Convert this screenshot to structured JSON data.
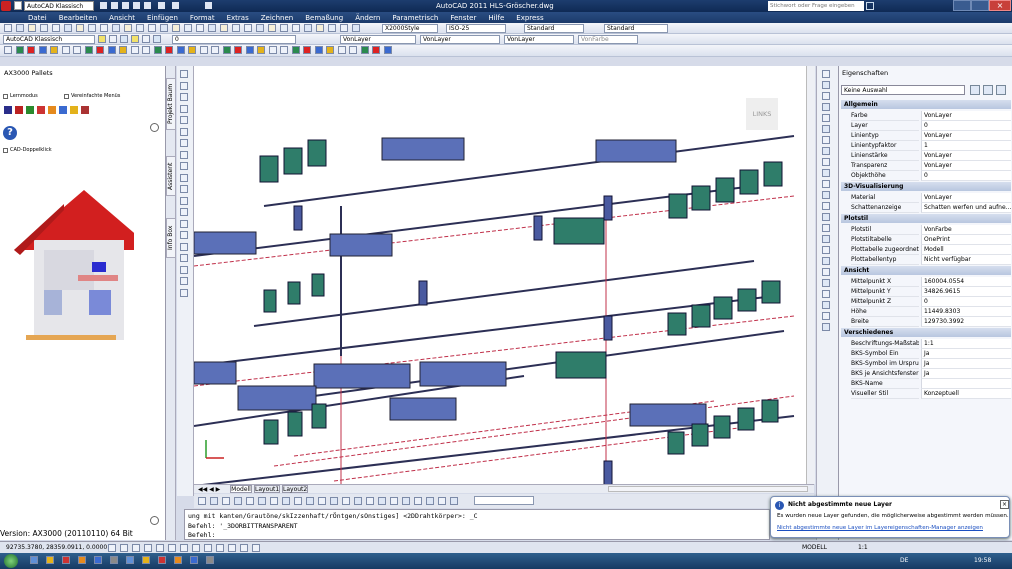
{
  "title_bar": {
    "app_title": "AutoCAD 2011   HLS-Gröscher.dwg",
    "workspace": "AutoCAD Klassisch",
    "search_placeholder": "Stichwort oder Frage eingeben"
  },
  "menu": [
    "Datei",
    "Bearbeiten",
    "Ansicht",
    "Einfügen",
    "Format",
    "Extras",
    "Zeichnen",
    "Bemaßung",
    "Ändern",
    "Parametrisch",
    "Fenster",
    "Hilfe",
    "Express"
  ],
  "toolbar": {
    "text_style": "X2000Style",
    "dim_style": "ISO-25",
    "table_style": "Standard",
    "mleader_style": "Standard",
    "workspace_select": "AutoCAD Klassisch",
    "layer_select": "0",
    "color_select": "VonLayer",
    "linetype_select": "VonLayer",
    "lineweight_select": "VonLayer",
    "plotstyle_select": "VonFarbe"
  },
  "left_panel": {
    "title": "AX3000 Pallets",
    "checkbox_lernmodus": "Lernmodus",
    "checkbox_menu": "Vereinfachte Menüs",
    "checkbox_cad": "CAD-Doppelklick",
    "version": "Version: AX3000 (20110110) 64 Bit"
  },
  "vertical_tabs": [
    "Projekt Baum",
    "Assistent",
    "Info Box"
  ],
  "viewcube_label": "LINKS",
  "layout_tabs": [
    "Modell",
    "Layout1",
    "Layout2"
  ],
  "command": {
    "line1": "ung mit kanten/Grautöne/skIzzenhaft/rÖntgen/sOnstiges] <2DDrahtkörper>: _C",
    "line2": "Befehl: '_3DORBITTRANSPARENT",
    "line3": "Befehl:"
  },
  "properties": {
    "title": "Eigenschaften",
    "selection": "Keine Auswahl",
    "sections": [
      {
        "name": "Allgemein",
        "rows": [
          [
            "Farbe",
            "VonLayer"
          ],
          [
            "Layer",
            "0"
          ],
          [
            "Linientyp",
            "VonLayer"
          ],
          [
            "Linientypfaktor",
            "1"
          ],
          [
            "Linienstärke",
            "VonLayer"
          ],
          [
            "Transparenz",
            "VonLayer"
          ],
          [
            "Objekthöhe",
            "0"
          ]
        ]
      },
      {
        "name": "3D-Visualisierung",
        "rows": [
          [
            "Material",
            "VonLayer"
          ],
          [
            "Schattenanzeige",
            "Schatten werfen und aufne..."
          ]
        ]
      },
      {
        "name": "Plotstil",
        "rows": [
          [
            "Plotstil",
            "VonFarbe"
          ],
          [
            "Plotstiltabelle",
            "OnePrint"
          ],
          [
            "Plottabelle zugeordnet...",
            "Modell"
          ],
          [
            "Plottabellentyp",
            "Nicht verfügbar"
          ]
        ]
      },
      {
        "name": "Ansicht",
        "rows": [
          [
            "Mittelpunkt X",
            "160004.0554"
          ],
          [
            "Mittelpunkt Y",
            "34826.9615"
          ],
          [
            "Mittelpunkt Z",
            "0"
          ],
          [
            "Höhe",
            "11449.8303"
          ],
          [
            "Breite",
            "129730.3992"
          ]
        ]
      },
      {
        "name": "Verschiedenes",
        "rows": [
          [
            "Beschriftungs-Maßstab",
            "1:1"
          ],
          [
            "BKS-Symbol Ein",
            "Ja"
          ],
          [
            "BKS-Symbol im Urspru...",
            "Ja"
          ],
          [
            "BKS je Ansichtsfenster",
            "Ja"
          ],
          [
            "BKS-Name",
            ""
          ],
          [
            "Visueller Stil",
            "Konzeptuell"
          ]
        ]
      }
    ]
  },
  "status": {
    "coords": "92735.3780, 28359.0911, 0.0000",
    "model_label": "MODELL",
    "scale": "1:1",
    "time": "19:58",
    "lang": "DE"
  },
  "notification": {
    "title": "Nicht abgestimmte neue Layer",
    "body": "Es wurden neue Layer gefunden, die möglicherweise abgestimmt werden müssen.",
    "link": "Nicht abgestimmte neue Layer im Layereigenschaften-Manager anzeigen"
  },
  "colors": {
    "title_bg": "#1d3d6e",
    "radiator_blue": "#5b70b8",
    "radiator_teal": "#2f7d6a",
    "pipe_red": "#c0304a"
  }
}
